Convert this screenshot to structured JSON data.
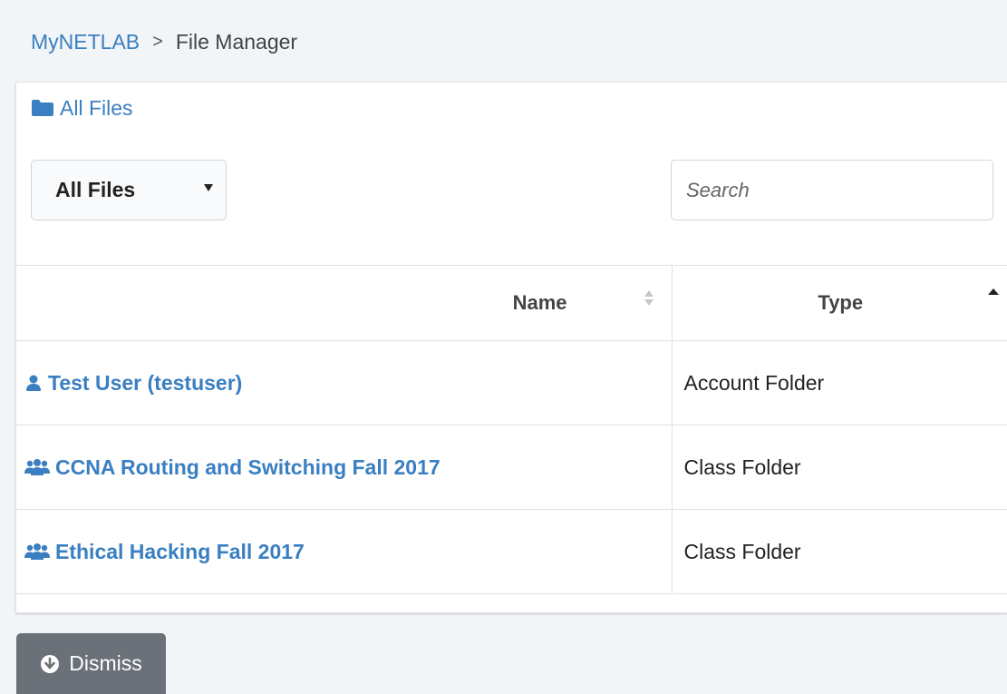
{
  "breadcrumb": {
    "root": "MyNETLAB",
    "separator": ">",
    "current": "File Manager"
  },
  "panel": {
    "title": "All Files",
    "title_icon": "folder-icon"
  },
  "filter": {
    "selected": "All Files"
  },
  "search": {
    "placeholder": "Search",
    "value": ""
  },
  "table": {
    "columns": [
      {
        "label": "Name",
        "sort": "unsorted"
      },
      {
        "label": "Type",
        "sort": "ascending"
      }
    ],
    "rows": [
      {
        "icon": "user-icon",
        "name": "Test User (testuser)",
        "type": "Account Folder"
      },
      {
        "icon": "users-icon",
        "name": "CCNA Routing and Switching Fall 2017",
        "type": "Class Folder"
      },
      {
        "icon": "users-icon",
        "name": "Ethical Hacking Fall 2017",
        "type": "Class Folder"
      }
    ]
  },
  "dismiss": {
    "label": "Dismiss",
    "icon": "arrow-circle-down-icon"
  },
  "colors": {
    "link": "#3a7fc1",
    "button": "#6b7178",
    "background": "#f2f5f8"
  }
}
